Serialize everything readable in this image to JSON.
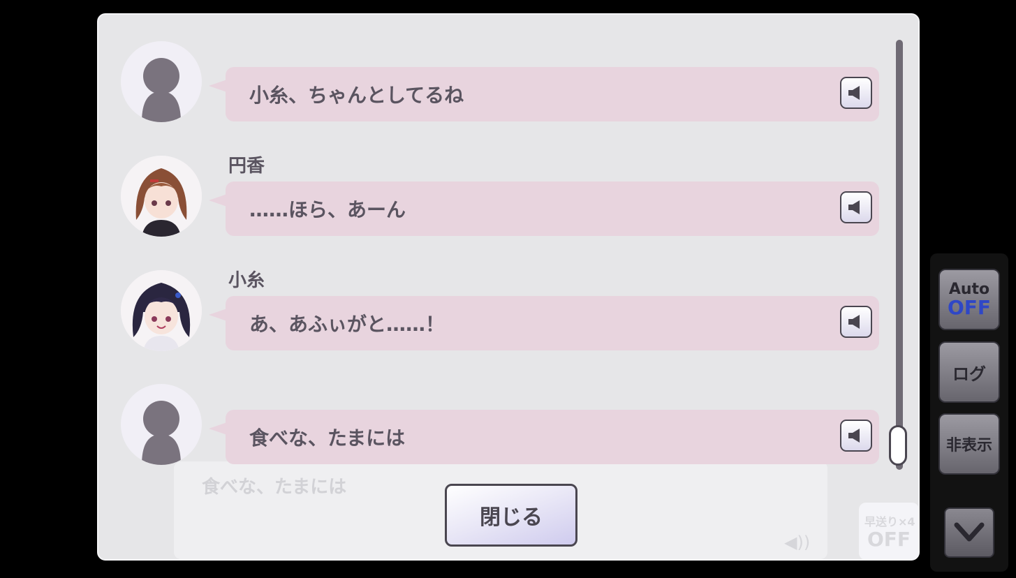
{
  "log": {
    "entries": [
      {
        "speaker": "",
        "text": "小糸、ちゃんとしてるね",
        "avatar": "silhouette"
      },
      {
        "speaker": "円香",
        "text": "……ほら、あーん",
        "avatar": "madoka"
      },
      {
        "speaker": "小糸",
        "text": "あ、あふぃがと……！",
        "avatar": "koito"
      },
      {
        "speaker": "",
        "text": "食べな、たまには",
        "avatar": "silhouette"
      }
    ],
    "close_label": "閉じる"
  },
  "background": {
    "message_text": "食べな、たまには",
    "fast_forward_label": "早送り×4",
    "fast_forward_state": "OFF"
  },
  "controls": {
    "auto_label": "Auto",
    "auto_state": "OFF",
    "log_label": "ログ",
    "hide_label": "非表示"
  },
  "colors": {
    "bubble": "#e8d4de",
    "panel": "#e6e6e8",
    "text": "#5a5460",
    "auto_off": "#2f47c6"
  }
}
